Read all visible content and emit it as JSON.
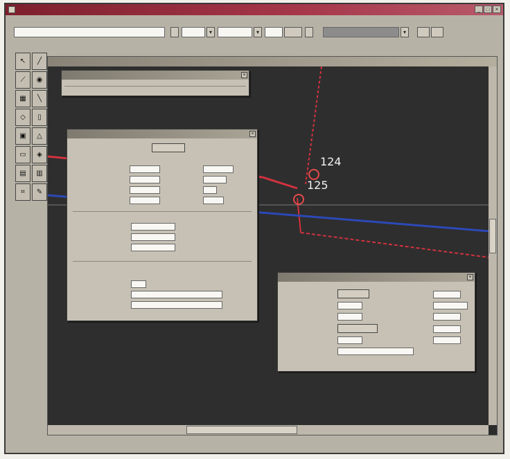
{
  "colors": {
    "red_line": "#d2323f",
    "blue_line": "#2c49b8",
    "canvas_bg": "#2e2e2e",
    "node": "#e84a4a"
  },
  "canvas": {
    "node_labels": [
      "124",
      "125"
    ]
  },
  "tools": [
    "arrow-tool",
    "line-tool",
    "pipe-tool",
    "node-tool",
    "zoom-tool",
    "pan-tool",
    "shape-tool",
    "text-tool",
    "select-tool",
    "measure-tool",
    "rect-tool",
    "label-tool"
  ]
}
